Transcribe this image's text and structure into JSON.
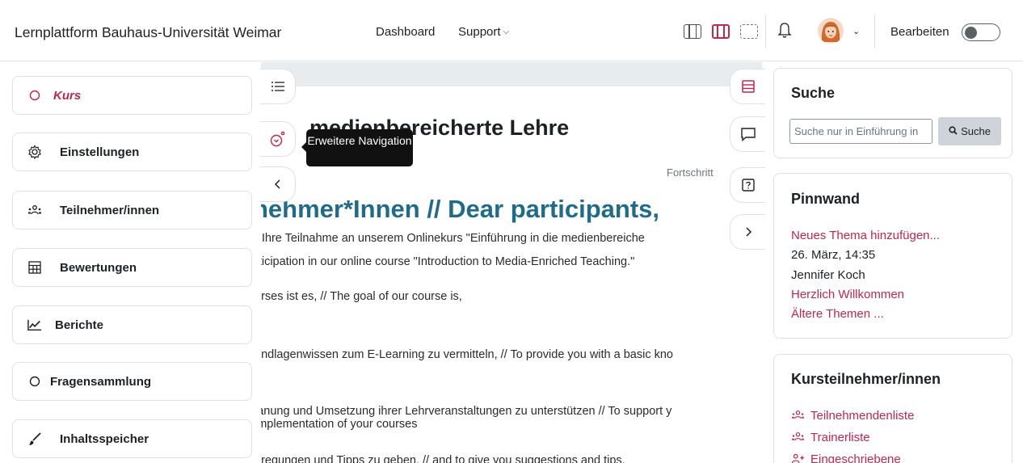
{
  "header": {
    "site_name": "Lernplattform Bauhaus-Universität Weimar",
    "nav": [
      {
        "label": "Dashboard"
      },
      {
        "label": "Support"
      }
    ],
    "edit_label": "Bearbeiten",
    "accent_color": "#c3264b"
  },
  "course_index": {
    "items": [
      {
        "label": "Kurs",
        "icon": "circle-icon",
        "active": true
      },
      {
        "label": "Einstellungen",
        "icon": "gear-icon"
      },
      {
        "label": "Teilnehmer/innen",
        "icon": "users-icon"
      },
      {
        "label": "Bewertungen",
        "icon": "table-icon"
      },
      {
        "label": "Berichte",
        "icon": "chart-line-icon"
      },
      {
        "label": "Fragensammlung",
        "icon": "circle-icon"
      },
      {
        "label": "Inhaltsspeicher",
        "icon": "brush-icon"
      }
    ]
  },
  "main": {
    "course_title": "medienbereicherte Lehre",
    "tooltip": "Erweitere Navigation",
    "progress_label": "Fortschritt",
    "heading": "nehmer*Innen // Dear participants,",
    "lines": [
      "r Ihre Teilnahme an unserem Onlinekurs \"Einführung in die medienbereiche",
      "rticipation in our online course \"Introduction to Media-Enriched Teaching.\"",
      "urses ist es, // The goal of our course is,",
      "undlagenwissen zum E-Learning zu vermitteln, // To provide you with a basic kno",
      "lanung und Umsetzung ihrer Lehrveranstaltungen zu unterstützen // To support y",
      " implementation of your courses",
      "nregungen und Tipps zu geben. // and to give you suggestions and tips."
    ]
  },
  "blocks": {
    "search": {
      "title": "Suche",
      "placeholder": "Suche nur in Einführung in",
      "button": "Suche"
    },
    "pinnwand": {
      "title": "Pinnwand",
      "add_topic": "Neues Thema hinzufügen...",
      "date": "26. März, 14:35",
      "author": "Jennifer Koch",
      "post": "Herzlich Willkommen",
      "older": "Ältere Themen ..."
    },
    "participants": {
      "title": "Kursteilnehmer/innen",
      "links": [
        {
          "label": "Teilnehmendenliste",
          "icon": "users-icon"
        },
        {
          "label": "Trainerliste",
          "icon": "users-icon"
        },
        {
          "label": "Eingeschriebene",
          "icon": "user-plus-icon"
        }
      ]
    }
  }
}
